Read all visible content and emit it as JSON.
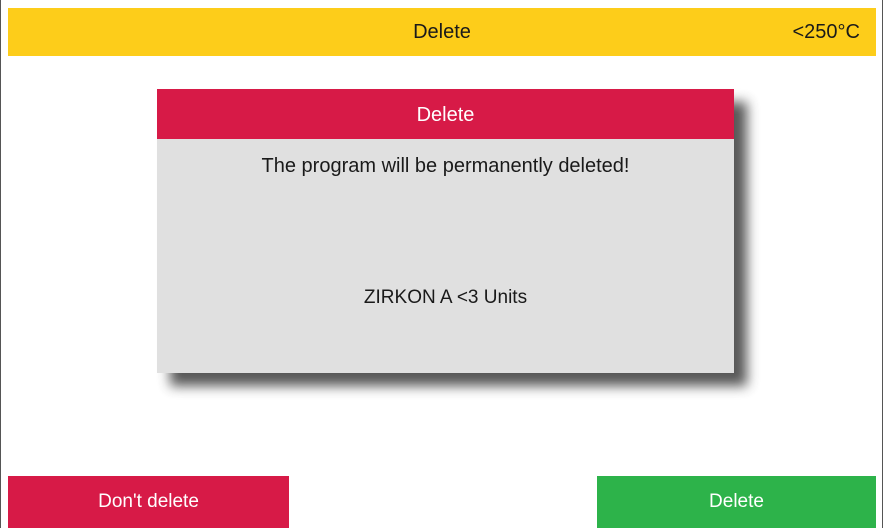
{
  "header": {
    "title": "Delete",
    "temperature": "<250°C"
  },
  "dialog": {
    "title": "Delete",
    "message": "The program will be permanently deleted!",
    "program_name": "ZIRKON A <3 Units"
  },
  "buttons": {
    "cancel_label": "Don't delete",
    "confirm_label": "Delete"
  },
  "colors": {
    "header_bg": "#fdcd1a",
    "dialog_header_bg": "#d71a47",
    "dialog_body_bg": "#e0e0e0",
    "cancel_bg": "#d71a47",
    "confirm_bg": "#2db34a"
  }
}
